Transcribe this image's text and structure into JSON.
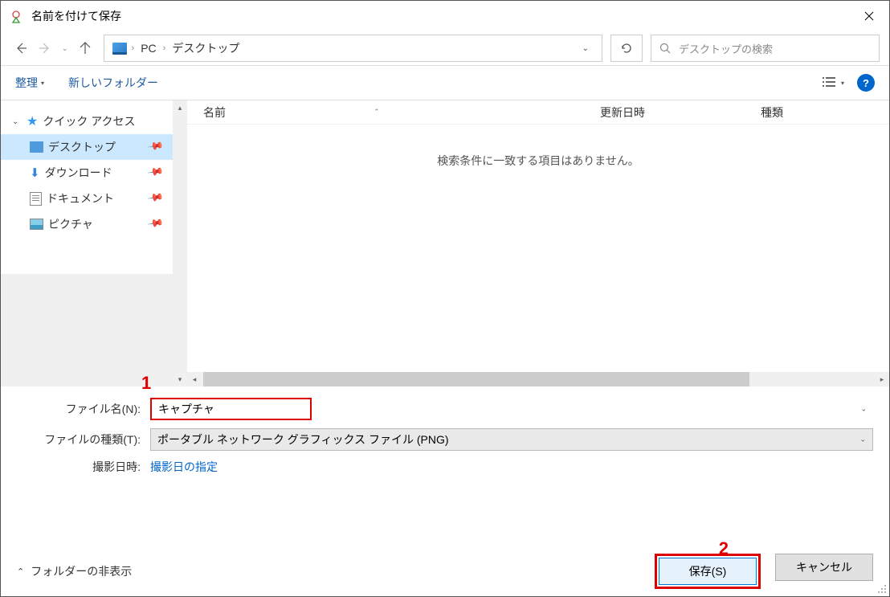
{
  "titlebar": {
    "title": "名前を付けて保存"
  },
  "breadcrumb": {
    "pc": "PC",
    "desktop": "デスクトップ"
  },
  "search": {
    "placeholder": "デスクトップの検索"
  },
  "toolbar": {
    "organize": "整理",
    "new_folder": "新しいフォルダー"
  },
  "tree": {
    "quick_access": "クイック アクセス",
    "desktop": "デスクトップ",
    "downloads": "ダウンロード",
    "documents": "ドキュメント",
    "pictures": "ピクチャ"
  },
  "columns": {
    "name": "名前",
    "date": "更新日時",
    "type": "種類"
  },
  "content": {
    "empty": "検索条件に一致する項目はありません。"
  },
  "form": {
    "filename_label": "ファイル名(N):",
    "filename_value": "キャプチャ",
    "filetype_label": "ファイルの種類(T):",
    "filetype_value": "ポータブル ネットワーク グラフィックス ファイル (PNG)",
    "date_label": "撮影日時:",
    "date_link": "撮影日の指定"
  },
  "footer": {
    "folder_toggle": "フォルダーの非表示",
    "save": "保存(S)",
    "cancel": "キャンセル"
  },
  "annotations": {
    "one": "1",
    "two": "2"
  }
}
